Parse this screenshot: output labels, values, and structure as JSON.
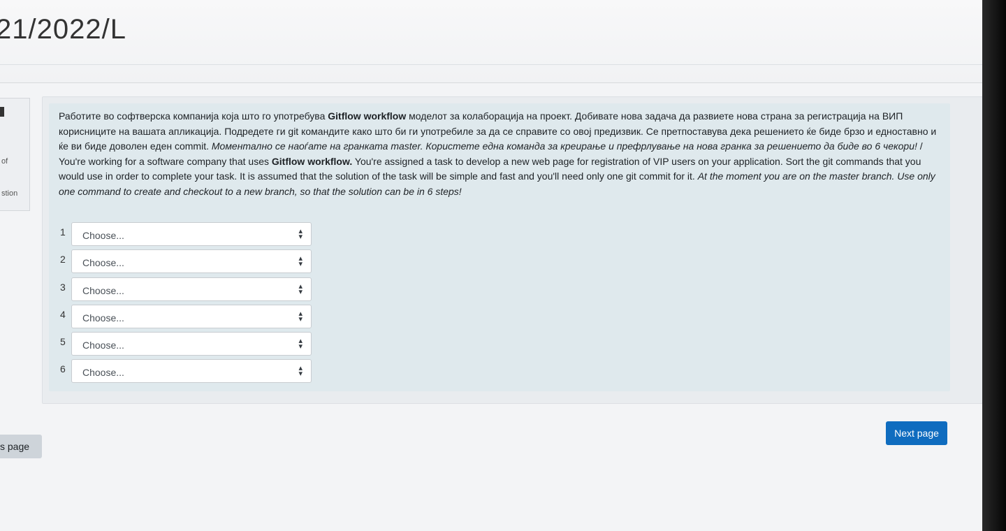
{
  "header": {
    "title": "21/2022/L"
  },
  "sidebar_info": {
    "line1": "of",
    "line2": "stion"
  },
  "question": {
    "text_mk_1": "Работите во софтверска компанија која што го употребува ",
    "bold_1": "Gitflow workflow",
    "text_mk_2": " моделот за колаборација на проект. Добивате нова задача да развиете нова страна за регистрација на ВИП корисниците на вашата апликација. Подредете ги git командите како што би ги употребиле за да се справите со овој предизвик. Се претпоставува дека решението ќе биде брзо и едноставно и ќе ви биде доволен еден commit. ",
    "italic_mk": "Моментално се наоѓате на гранката master. Користете една команда за креирање и префрлување на нова гранка за решението да биде во 6 чекори!",
    "text_en_1": " / You're working for a software company that uses ",
    "bold_2": "Gitflow workflow.",
    "text_en_2": " You're assigned a task to develop a new web page for registration of VIP users on your application. Sort the git commands that you would use in order to complete your task. It is assumed that the solution of the task will be simple and fast and you'll need only one git commit for it. ",
    "italic_en": "At the moment you are on the master branch. Use only one command to create and checkout to a new branch, so that the solution can be in 6 steps!"
  },
  "answers": [
    {
      "num": "1",
      "value": "Choose..."
    },
    {
      "num": "2",
      "value": "Choose..."
    },
    {
      "num": "3",
      "value": "Choose..."
    },
    {
      "num": "4",
      "value": "Choose..."
    },
    {
      "num": "5",
      "value": "Choose..."
    },
    {
      "num": "6",
      "value": "Choose..."
    }
  ],
  "navigation": {
    "previous_label": "s page",
    "next_label": "Next page"
  },
  "icons": {
    "select_arrow": "up-down-arrows-icon"
  },
  "colors": {
    "primary": "#0f6cbf",
    "panel": "#dfe9ed"
  }
}
